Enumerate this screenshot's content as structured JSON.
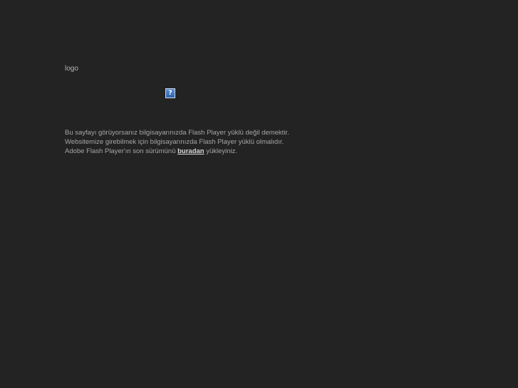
{
  "logo": {
    "text": "logo"
  },
  "plugin": {
    "icon": "missing-plugin-icon",
    "glyph": "?"
  },
  "message": {
    "line1": "Bu sayfayı görüyorsanız bilgisayarınızda Flash Player yüklü değil demektir.",
    "line2": "Websitemize girebilmek için bilgisayarınızda Flash Player yüklü olmalıdır.",
    "line3_prefix": "Adobe Flash Player'ın son sürümünü ",
    "line3_link": "buradan",
    "line3_suffix": " yükleyiniz."
  },
  "colors": {
    "background": "#232323",
    "text": "#a6a6a6",
    "link": "#d8d8d8",
    "icon": "#2d63b0"
  }
}
